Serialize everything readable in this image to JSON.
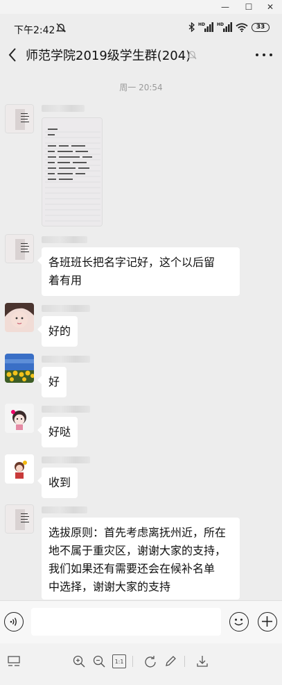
{
  "window": {
    "minimize_symbol": "—",
    "maximize_symbol": "☐",
    "close_symbol": "✕"
  },
  "status_bar": {
    "time": "下午2:42",
    "battery": "33",
    "hd_label": "HD",
    "icons": [
      "do-not-disturb-icon",
      "bluetooth-icon",
      "signal-hd-icon",
      "signal-hd-icon",
      "wifi-icon",
      "battery-icon"
    ]
  },
  "header": {
    "title": "师范学院2019级学生群(204)",
    "icons": [
      "back-icon",
      "mute-bell-icon",
      "more-icon"
    ]
  },
  "timestamp": "周一 20:54",
  "messages": [
    {
      "type": "image",
      "content_text": [
        "2019级",
        "班长 联系人 电话号 大学",
        "1班 ——",
        "2班 ——",
        "3班 ——",
        "4班 ——"
      ]
    },
    {
      "type": "text",
      "lines": [
        "各班班长把名字记好，这个以后留",
        "着有用"
      ]
    },
    {
      "type": "text",
      "lines": [
        "好的"
      ]
    },
    {
      "type": "text",
      "lines": [
        "好"
      ]
    },
    {
      "type": "text",
      "lines": [
        "好哒"
      ]
    },
    {
      "type": "text",
      "lines": [
        "收到"
      ]
    },
    {
      "type": "text",
      "lines": [
        "选拔原则：首先考虑离抚州近，所在",
        "地不属于重灾区，谢谢大家的支持，",
        "我们如果还有需要还会在候补名单",
        "中选择，谢谢大家的支持"
      ]
    }
  ],
  "input_bar": {
    "icons": [
      "voice-icon",
      "emoji-icon",
      "plus-icon"
    ],
    "value": ""
  },
  "toolbar": {
    "icons": [
      "layout-icon",
      "zoom-in-icon",
      "zoom-out-icon",
      "actual-size-icon",
      "rotate-icon",
      "edit-icon",
      "download-icon"
    ],
    "actual_size_label": "1:1"
  },
  "colors": {
    "background": "#ededed",
    "bubble": "#ffffff",
    "text": "#111111",
    "timestamp": "#9a9a9a"
  }
}
